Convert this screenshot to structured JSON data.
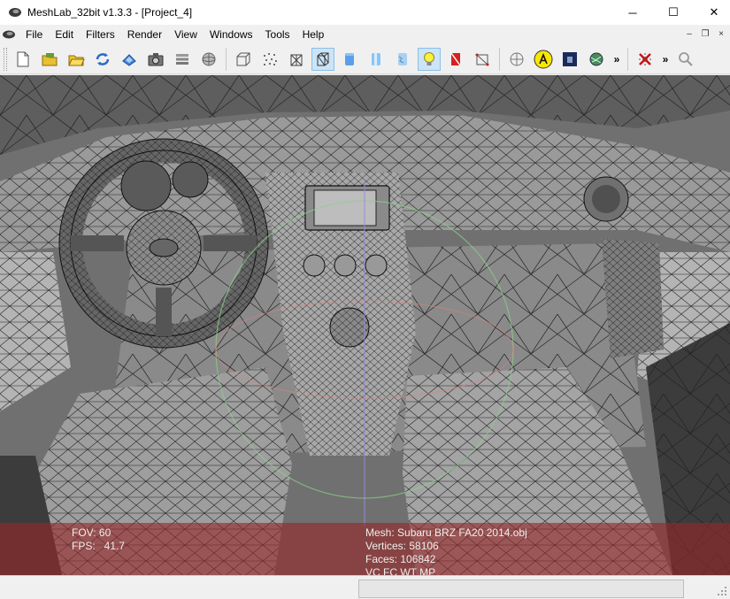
{
  "window": {
    "title": "MeshLab_32bit v1.3.3 - [Project_4]",
    "controls": {
      "minimize": "─",
      "maximize": "☐",
      "close": "✕"
    }
  },
  "menu": {
    "items": [
      "File",
      "Edit",
      "Filters",
      "Render",
      "View",
      "Windows",
      "Tools",
      "Help"
    ],
    "mdi_controls": {
      "minimize": "–",
      "restore": "❐",
      "close": "×"
    }
  },
  "toolbar": {
    "more_label": "»",
    "groups": [
      [
        "new-document-icon",
        "open-project-icon",
        "open-folder-icon",
        "reload-icon",
        "save-icon",
        "snapshot-camera-icon",
        "layers-icon",
        "sphere-icon"
      ],
      [
        "bounding-box-icon",
        "points-icon",
        "wireframe-icon",
        "hidden-lines-icon",
        "flat-shading-icon",
        "smooth-shading-icon",
        "texture-icon",
        "light-bulb-icon",
        "color-per-face-icon",
        "selection-icon"
      ],
      [
        "trackball-icon",
        "annotation-a-icon",
        "raster-icon",
        "texture-ball-icon"
      ],
      [
        "delete-faces-icon",
        "search-icon"
      ]
    ],
    "active": [
      "wireframe-icon",
      "hidden-lines-icon",
      "light-bulb-icon"
    ],
    "colors": {
      "active_bg": "#cce4f7",
      "active_border": "#8cbfe8"
    }
  },
  "viewport": {
    "colors": {
      "mesh_bg": "#6e6e6e",
      "info_overlay": "#962828"
    },
    "info_left": {
      "fov": "FOV: 60",
      "fps": "FPS:   41.7"
    },
    "info_right": {
      "mesh": "Mesh: Subaru BRZ FA20 2014.obj",
      "vertices": "Vertices: 58106",
      "faces": "Faces: 106842",
      "flags": "VC FC WT MP"
    }
  },
  "statusbar": {
    "text": ""
  }
}
